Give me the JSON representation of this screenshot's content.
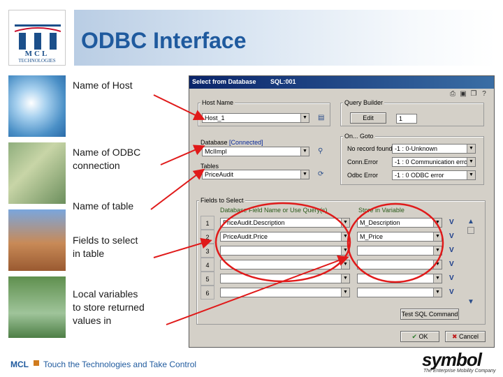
{
  "slide": {
    "title": "ODBC Interface",
    "logo": {
      "name": "MCL",
      "sub": "TECHNOLOGIES"
    },
    "labels": [
      "Name of Host",
      "Name of ODBC\nconnection",
      "Name of table",
      "Fields to select\nin table",
      "Local variables\nto store returned\nvalues in"
    ],
    "footer": {
      "mcl": "MCL",
      "tagline": "Touch the Technologies and Take Control",
      "brand": "symbol",
      "brand_sub": "The Enterprise Mobility Company"
    }
  },
  "dialog": {
    "title": "Select from Database",
    "id": "SQL:001",
    "host": {
      "group": "Host Name",
      "value": "Host_1"
    },
    "query_builder": {
      "group": "Query Builder",
      "edit_label": "Edit",
      "value": "1"
    },
    "on_goto": {
      "group": "On... Goto",
      "rows": [
        {
          "label": "No record found",
          "value": "-1 : 0-Unknown"
        },
        {
          "label": "Conn.Error",
          "value": "-1 : 0 Communication error"
        },
        {
          "label": "Odbc Error",
          "value": "-1 : 0 ODBC error"
        }
      ]
    },
    "database": {
      "label": "Database",
      "status": "[Connected]",
      "value": "McIImpl"
    },
    "tables": {
      "label": "Tables",
      "value": "PriceAudit"
    },
    "fields": {
      "group": "Fields to Select",
      "col_db": "Database Field Name or Use Query(s)",
      "col_var": "Store in Variable",
      "rows": [
        {
          "num": "1",
          "db": "PriceAudit.Description",
          "var": "M_Description"
        },
        {
          "num": "2",
          "db": "PriceAudit.Price",
          "var": "M_Price"
        },
        {
          "num": "3",
          "db": "",
          "var": ""
        },
        {
          "num": "4",
          "db": "",
          "var": ""
        },
        {
          "num": "5",
          "db": "",
          "var": ""
        },
        {
          "num": "6",
          "db": "",
          "var": ""
        }
      ],
      "v_label": "V",
      "test_label": "Test SQL Command"
    },
    "ok_label": "OK",
    "cancel_label": "Cancel"
  },
  "colors": {
    "title": "#1f5a9e",
    "arrow": "#e01a1a",
    "titlebar": "#0a246a"
  }
}
